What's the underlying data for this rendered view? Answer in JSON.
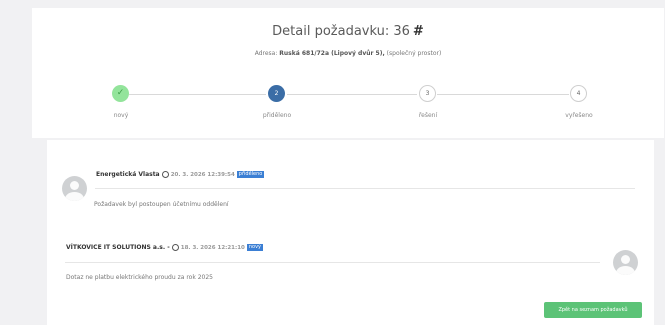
{
  "header": {
    "title_prefix": "Detail požadavku: 36",
    "title_hash": "#",
    "address_label": "Adresa:",
    "address_value": "Ruská 681/72a (Lipový dvůr 5),",
    "address_note": "(společný prostor)"
  },
  "steps": [
    {
      "label": "nový",
      "marker": "✓",
      "state": "done"
    },
    {
      "label": "přiděleno",
      "marker": "2",
      "state": "active"
    },
    {
      "label": "řešení",
      "marker": "3",
      "state": "pending"
    },
    {
      "label": "vyřešeno",
      "marker": "4",
      "state": "pending"
    }
  ],
  "history": [
    {
      "author": "Energetická Vlasta",
      "datetime": "20. 3. 2026 12:39:54",
      "badge": "přiděleno",
      "message": "Požadavek byl postoupen účetnímu oddělení"
    },
    {
      "author": "VÍTKOVICE IT SOLUTIONS a.s. -",
      "datetime": "18. 3. 2026 12:21:10",
      "badge": "nový",
      "message": "Dotaz ne platbu elektrického proudu za rok 2025"
    }
  ],
  "back_button_label": "Zpět na seznam požadavků",
  "colors": {
    "done": "#93e49b",
    "active": "#3b6da6",
    "badge": "#3b7fd4",
    "button": "#5cc377"
  }
}
